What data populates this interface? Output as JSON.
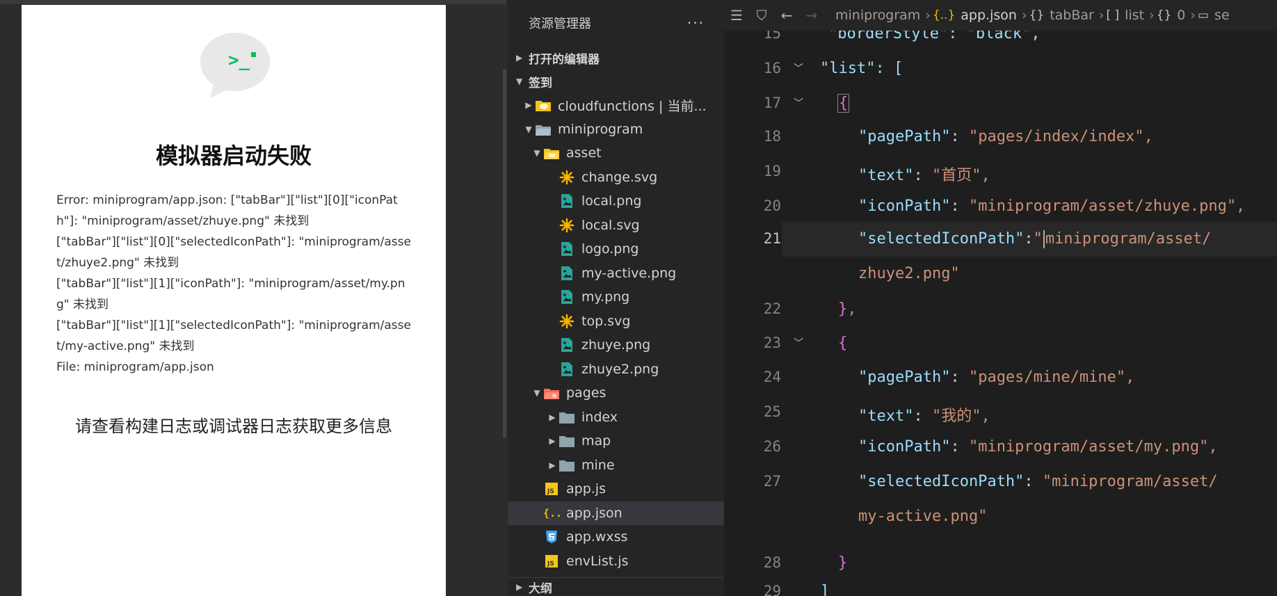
{
  "simulator": {
    "icon": "terminal-bubble-icon",
    "icon_prompt": ">_",
    "title": "模拟器启动失败",
    "error_lines": [
      "Error: miniprogram/app.json: [\"tabBar\"][\"list\"][0][\"iconPath\"]: \"miniprogram/asset/zhuye.png\" 未找到",
      "[\"tabBar\"][\"list\"][0][\"selectedIconPath\"]: \"miniprogram/asset/zhuye2.png\" 未找到",
      "[\"tabBar\"][\"list\"][1][\"iconPath\"]: \"miniprogram/asset/my.png\" 未找到",
      "[\"tabBar\"][\"list\"][1][\"selectedIconPath\"]: \"miniprogram/asset/my-active.png\" 未找到",
      "File: miniprogram/app.json"
    ],
    "hint": "请查看构建日志或调试器日志获取更多信息"
  },
  "explorer": {
    "title": "资源管理器",
    "more": "···",
    "sections": {
      "open_editors": "打开的编辑器",
      "project": "签到",
      "outline": "大纲"
    },
    "tree": [
      {
        "label": "cloudfunctions | 当前...",
        "icon": "cloud-folder-icon",
        "indent": 1,
        "tri": "▶"
      },
      {
        "label": "miniprogram",
        "icon": "folder-open-icon",
        "indent": 1,
        "tri": "▼"
      },
      {
        "label": "asset",
        "icon": "asset-folder-icon",
        "indent": 2,
        "tri": "▼"
      },
      {
        "label": "change.svg",
        "icon": "svg-file-icon",
        "indent": 3,
        "tri": ""
      },
      {
        "label": "local.png",
        "icon": "image-file-icon",
        "indent": 3,
        "tri": ""
      },
      {
        "label": "local.svg",
        "icon": "svg-file-icon",
        "indent": 3,
        "tri": ""
      },
      {
        "label": "logo.png",
        "icon": "image-file-icon",
        "indent": 3,
        "tri": ""
      },
      {
        "label": "my-active.png",
        "icon": "image-file-icon",
        "indent": 3,
        "tri": ""
      },
      {
        "label": "my.png",
        "icon": "image-file-icon",
        "indent": 3,
        "tri": ""
      },
      {
        "label": "top.svg",
        "icon": "svg-file-icon",
        "indent": 3,
        "tri": ""
      },
      {
        "label": "zhuye.png",
        "icon": "image-file-icon",
        "indent": 3,
        "tri": ""
      },
      {
        "label": "zhuye2.png",
        "icon": "image-file-icon",
        "indent": 3,
        "tri": ""
      },
      {
        "label": "pages",
        "icon": "pages-folder-icon",
        "indent": 2,
        "tri": "▼"
      },
      {
        "label": "index",
        "icon": "folder-icon",
        "indent": 3,
        "tri": "▶"
      },
      {
        "label": "map",
        "icon": "folder-icon",
        "indent": 3,
        "tri": "▶"
      },
      {
        "label": "mine",
        "icon": "folder-icon",
        "indent": 3,
        "tri": "▶"
      },
      {
        "label": "app.js",
        "icon": "js-file-icon",
        "indent": 2,
        "tri": ""
      },
      {
        "label": "app.json",
        "icon": "json-file-icon",
        "indent": 2,
        "tri": "",
        "selected": true
      },
      {
        "label": "app.wxss",
        "icon": "css-file-icon",
        "indent": 2,
        "tri": ""
      },
      {
        "label": "envList.js",
        "icon": "js-file-icon",
        "indent": 2,
        "tri": ""
      }
    ]
  },
  "editor": {
    "breadcrumb": {
      "root": "miniprogram",
      "file": "app.json",
      "c1": "tabBar",
      "c2": "list",
      "c3": "0",
      "c4": "se"
    },
    "breadcrumb_icons": {
      "file": "{..}",
      "obj": "{}",
      "arr": "[ ]"
    },
    "lines": [
      {
        "ln": "15",
        "text": "borderStyle\": \"black\","
      },
      {
        "ln": "16",
        "text": "\"list\": ["
      },
      {
        "ln": "17",
        "text": "{"
      },
      {
        "ln": "18",
        "key": "\"pagePath\"",
        "value": "\"pages/index/index\","
      },
      {
        "ln": "19",
        "key": "\"text\"",
        "value": "\"首页\","
      },
      {
        "ln": "20",
        "key": "\"iconPath\"",
        "value": "\"miniprogram/asset/zhuye.png\","
      },
      {
        "ln": "21",
        "key": "\"selectedIconPath\"",
        "value_a": "\"",
        "value_b": "miniprogram/asset/"
      },
      {
        "ln": "",
        "value": "zhuye2.png\""
      },
      {
        "ln": "22",
        "text": "},"
      },
      {
        "ln": "23",
        "text": "{"
      },
      {
        "ln": "24",
        "key": "\"pagePath\"",
        "value": "\"pages/mine/mine\","
      },
      {
        "ln": "25",
        "key": "\"text\"",
        "value": "\"我的\","
      },
      {
        "ln": "26",
        "key": "\"iconPath\"",
        "value": "\"miniprogram/asset/my.png\","
      },
      {
        "ln": "27",
        "key": "\"selectedIconPath\"",
        "value": "\"miniprogram/asset/"
      },
      {
        "ln": "",
        "value": "my-active.png\""
      },
      {
        "ln": "28",
        "text": "}"
      },
      {
        "ln": "29",
        "text": "]"
      }
    ],
    "colon": ": ",
    "colon_tight": ":"
  },
  "colors": {
    "key": "#9cdcfe",
    "string": "#ce9178",
    "bracket": "#ffd700",
    "bracket_inner": "#da70d6",
    "json_icon": "#e8c000",
    "image_icon": "#26a69a",
    "svg_icon": "#ffb300"
  }
}
